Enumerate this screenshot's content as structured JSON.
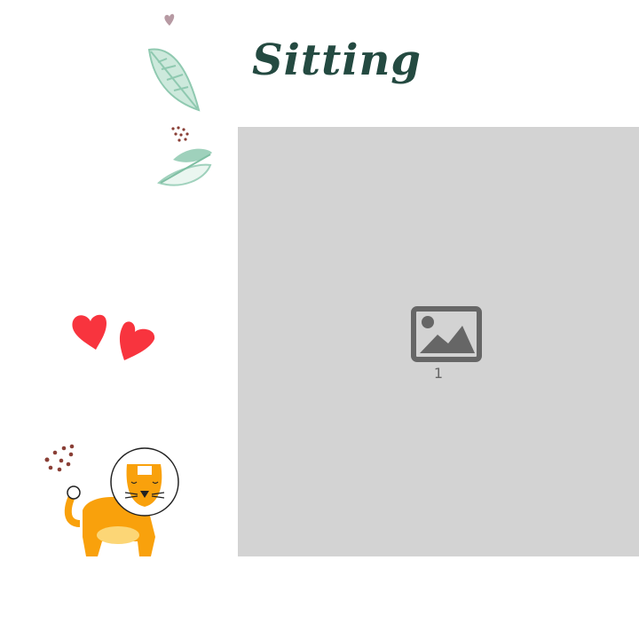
{
  "title": "Sitting",
  "placeholder": {
    "label": "1",
    "icon": "image-icon"
  },
  "colors": {
    "title": "#244a41",
    "placeholder_bg": "#d3d3d3",
    "heart": "#f8343e",
    "lion": "#f9a10c",
    "leaf": "#9fd1bc"
  }
}
